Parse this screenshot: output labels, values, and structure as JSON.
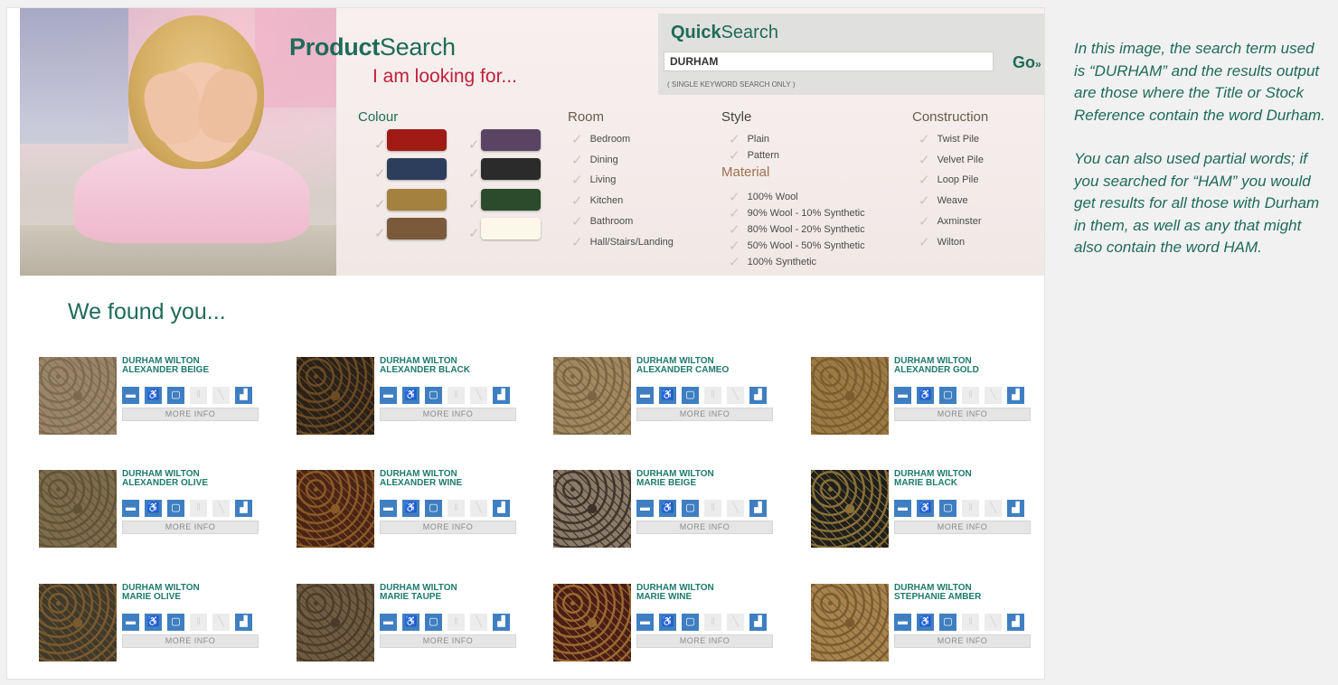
{
  "header": {
    "product_search_bold": "Product",
    "product_search_rest": "Search",
    "subtitle": "I am looking for..."
  },
  "quick_search": {
    "title_bold": "Quick",
    "title_rest": "Search",
    "input_value": "DURHAM",
    "go_label": "Go",
    "go_arrows": "»",
    "note": "( SINGLE KEYWORD SEARCH ONLY )"
  },
  "filters": {
    "colour": {
      "label": "Colour",
      "swatches": [
        "#a01b14",
        "#5b4463",
        "#2c3e5c",
        "#2b2b2b",
        "#a4813f",
        "#2c4b2c",
        "#7a5a3b",
        "#fbf8ea"
      ]
    },
    "room": {
      "label": "Room",
      "options": [
        "Bedroom",
        "Dining",
        "Living",
        "Kitchen",
        "Bathroom",
        "Hall/Stairs/Landing"
      ]
    },
    "style": {
      "label": "Style",
      "options": [
        "Plain",
        "Pattern"
      ]
    },
    "material": {
      "label": "Material",
      "options": [
        "100% Wool",
        "90% Wool - 10% Synthetic",
        "80% Wool - 20% Synthetic",
        "50% Wool - 50% Synthetic",
        "100% Synthetic"
      ]
    },
    "construction": {
      "label": "Construction",
      "options": [
        "Twist Pile",
        "Velvet Pile",
        "Loop Pile",
        "Weave",
        "Axminster",
        "Wilton"
      ]
    }
  },
  "results": {
    "heading": "We found you...",
    "more_info_label": "MORE INFO",
    "products": [
      {
        "line1": "DURHAM WILTON",
        "line2": "ALEXANDER BEIGE",
        "color": "#9b8568",
        "pattern": "#7d6a50"
      },
      {
        "line1": "DURHAM WILTON",
        "line2": "ALEXANDER BLACK",
        "color": "#2a2118",
        "pattern": "#6b4a24"
      },
      {
        "line1": "DURHAM WILTON",
        "line2": "ALEXANDER CAMEO",
        "color": "#a08860",
        "pattern": "#7a6442"
      },
      {
        "line1": "DURHAM WILTON",
        "line2": "ALEXANDER GOLD",
        "color": "#9b7a45",
        "pattern": "#7a5c2e"
      },
      {
        "line1": "DURHAM WILTON",
        "line2": "ALEXANDER OLIVE",
        "color": "#7e6c4b",
        "pattern": "#5f5237"
      },
      {
        "line1": "DURHAM WILTON",
        "line2": "ALEXANDER WINE",
        "color": "#4a2414",
        "pattern": "#8a5a28"
      },
      {
        "line1": "DURHAM WILTON",
        "line2": "MARIE BEIGE",
        "color": "#8a7a68",
        "pattern": "#3d332a"
      },
      {
        "line1": "DURHAM WILTON",
        "line2": "MARIE BLACK",
        "color": "#1f1f1c",
        "pattern": "#8a7038"
      },
      {
        "line1": "DURHAM WILTON",
        "line2": "MARIE OLIVE",
        "color": "#3f3a2a",
        "pattern": "#7a5a30"
      },
      {
        "line1": "DURHAM WILTON",
        "line2": "MARIE TAUPE",
        "color": "#6e5c42",
        "pattern": "#4a3c28"
      },
      {
        "line1": "DURHAM WILTON",
        "line2": "MARIE WINE",
        "color": "#4a1e16",
        "pattern": "#9a6a30"
      },
      {
        "line1": "DURHAM WILTON",
        "line2": "STEPHANIE AMBER",
        "color": "#a7834d",
        "pattern": "#7a5a30"
      }
    ],
    "room_icons": [
      "bedroom-icon",
      "dining-icon",
      "living-icon",
      "kitchen-icon",
      "bathroom-icon",
      "stairs-icon"
    ],
    "room_icon_states": [
      true,
      true,
      true,
      false,
      false,
      true
    ]
  },
  "side_note": {
    "p1": "In this image, the search term used is “DURHAM” and the results output are those where the Title or Stock Reference contain the word Durham.",
    "p2": "You can also used partial words; if you searched for “HAM” you would get results for all those with Durham in them, as well as any that might also contain the word HAM."
  }
}
